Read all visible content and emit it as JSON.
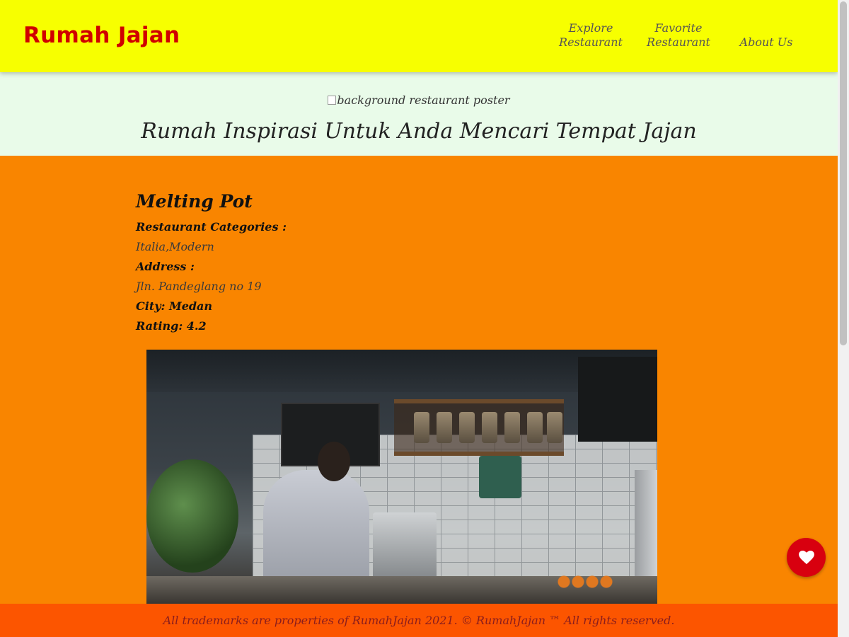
{
  "header": {
    "brand": "Rumah Jajan",
    "nav": [
      {
        "line1": "Explore",
        "line2": "Restaurant"
      },
      {
        "line1": "Favorite",
        "line2": "Restaurant"
      },
      {
        "line1": "About Us"
      }
    ]
  },
  "hero": {
    "image_alt": "background restaurant poster",
    "title": "Rumah Inspirasi Untuk Anda Mencari Tempat Jajan"
  },
  "restaurant": {
    "name": "Melting Pot",
    "categories_label": "Restaurant Categories :",
    "categories": "Italia,Modern",
    "address_label": "Address :",
    "address": "Jln. Pandeglang no 19",
    "city_text": "City: Medan",
    "rating_text": "Rating: 4.2"
  },
  "favorite_button": {
    "icon": "heart-icon"
  },
  "footer": {
    "text": "All trademarks are properties of RumahJajan 2021. © RumahJajan ™ All rights reserved."
  },
  "colors": {
    "header_bg": "#f7ff00",
    "brand": "#d00000",
    "hero_bg": "#e9fbe9",
    "main_bg": "#f98500",
    "footer_bg": "#fc5500",
    "favorite_button": "#d8000f"
  }
}
